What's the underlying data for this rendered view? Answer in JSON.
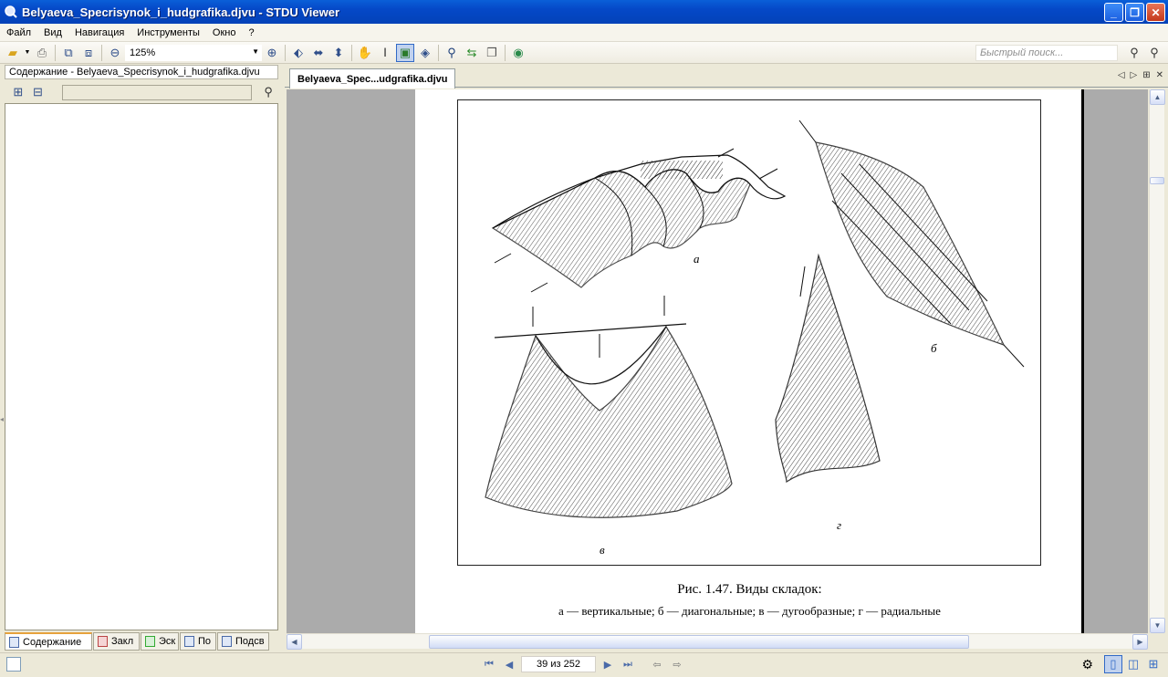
{
  "window": {
    "title": "Belyaeva_Specrisynok_i_hudgrafika.djvu - STDU Viewer",
    "min": "_",
    "max": "❐",
    "close": "✕"
  },
  "menu": [
    {
      "label": "Файл"
    },
    {
      "label": "Вид"
    },
    {
      "label": "Навигация"
    },
    {
      "label": "Инструменты"
    },
    {
      "label": "Окно"
    },
    {
      "label": "?"
    }
  ],
  "toolbar": {
    "zoom": "125%",
    "quick_search_placeholder": "Быстрый поиск..."
  },
  "sidebar": {
    "header": "Содержание - Belyaeva_Specrisynok_i_hudgrafika.djvu",
    "search_value": "",
    "tabs": [
      {
        "label": "Содержание",
        "icon": "contents-icon"
      },
      {
        "label": "Закл",
        "icon": "bookmark-icon"
      },
      {
        "label": "Эск",
        "icon": "thumbnail-icon"
      },
      {
        "label": "По",
        "icon": "search-icon"
      },
      {
        "label": "Подсв",
        "icon": "highlight-icon"
      }
    ]
  },
  "document": {
    "tab_label": "Belyaeva_Spec...udgrafika.djvu",
    "figure_labels": {
      "a": "а",
      "b": "б",
      "v": "в",
      "g": "г"
    },
    "caption": "Рис. 1.47. Виды складок:",
    "caption_detail": "а — вертикальные; б — диагональные; в — дугообразные; г — радиальные"
  },
  "status": {
    "page_indicator": "39 из 252"
  }
}
